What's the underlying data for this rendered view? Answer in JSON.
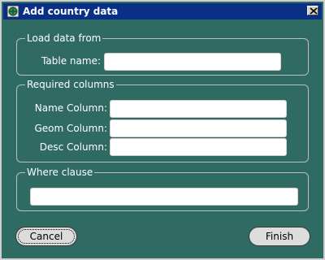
{
  "window": {
    "title": "Add country data",
    "app_icon": "globe-icon",
    "close_icon": "close-icon"
  },
  "load_group": {
    "title": "Load data from",
    "table_name_label": "Table name:",
    "table_name_value": ""
  },
  "required_group": {
    "title": "Required columns",
    "name_column_label": "Name Column:",
    "name_column_value": "",
    "geom_column_label": "Geom Column:",
    "geom_column_value": "",
    "desc_column_label": "Desc Column:",
    "desc_column_value": ""
  },
  "where_group": {
    "title": "Where clause",
    "where_value": ""
  },
  "buttons": {
    "cancel_label": "Cancel",
    "finish_label": "Finish"
  },
  "colors": {
    "background": "#2f6b63",
    "titlebar": "#0a2f86"
  }
}
